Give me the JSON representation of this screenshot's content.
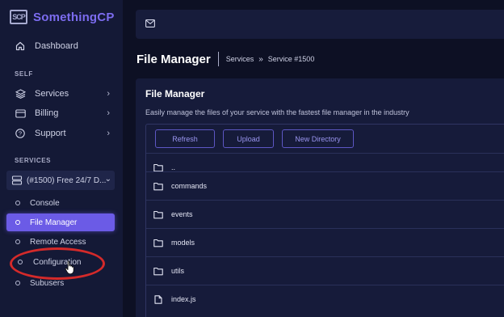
{
  "brand": {
    "logo_text": "SCP",
    "name": "SomethingCP"
  },
  "sidebar": {
    "dashboard_label": "Dashboard",
    "self_label": "SELF",
    "self_items": [
      {
        "label": "Services"
      },
      {
        "label": "Billing"
      },
      {
        "label": "Support"
      }
    ],
    "services_label": "SERVICES",
    "service_select_value": "(#1500) Free 24/7 D...",
    "service_items": [
      {
        "label": "Console"
      },
      {
        "label": "File Manager",
        "active": true
      },
      {
        "label": "Remote Access"
      },
      {
        "label": "Configuration"
      },
      {
        "label": "Subusers"
      }
    ]
  },
  "header": {
    "title": "File Manager",
    "breadcrumb": [
      "Services",
      "Service #1500"
    ],
    "breadcrumb_sep": "»"
  },
  "file_manager": {
    "title": "File Manager",
    "description": "Easily manage the files of your service with the fastest file manager in the industry",
    "buttons": {
      "refresh": "Refresh",
      "upload": "Upload",
      "new_directory": "New Directory"
    },
    "files": [
      {
        "name": "..",
        "type": "folder"
      },
      {
        "name": "commands",
        "type": "folder"
      },
      {
        "name": "events",
        "type": "folder"
      },
      {
        "name": "models",
        "type": "folder"
      },
      {
        "name": "utils",
        "type": "folder"
      },
      {
        "name": "index.js",
        "type": "file"
      }
    ]
  },
  "colors": {
    "background": "#0d1024",
    "sidebar": "#141936",
    "accent": "#6b5be6",
    "brand": "#7c6cf0",
    "annotation": "#d42a2a"
  }
}
